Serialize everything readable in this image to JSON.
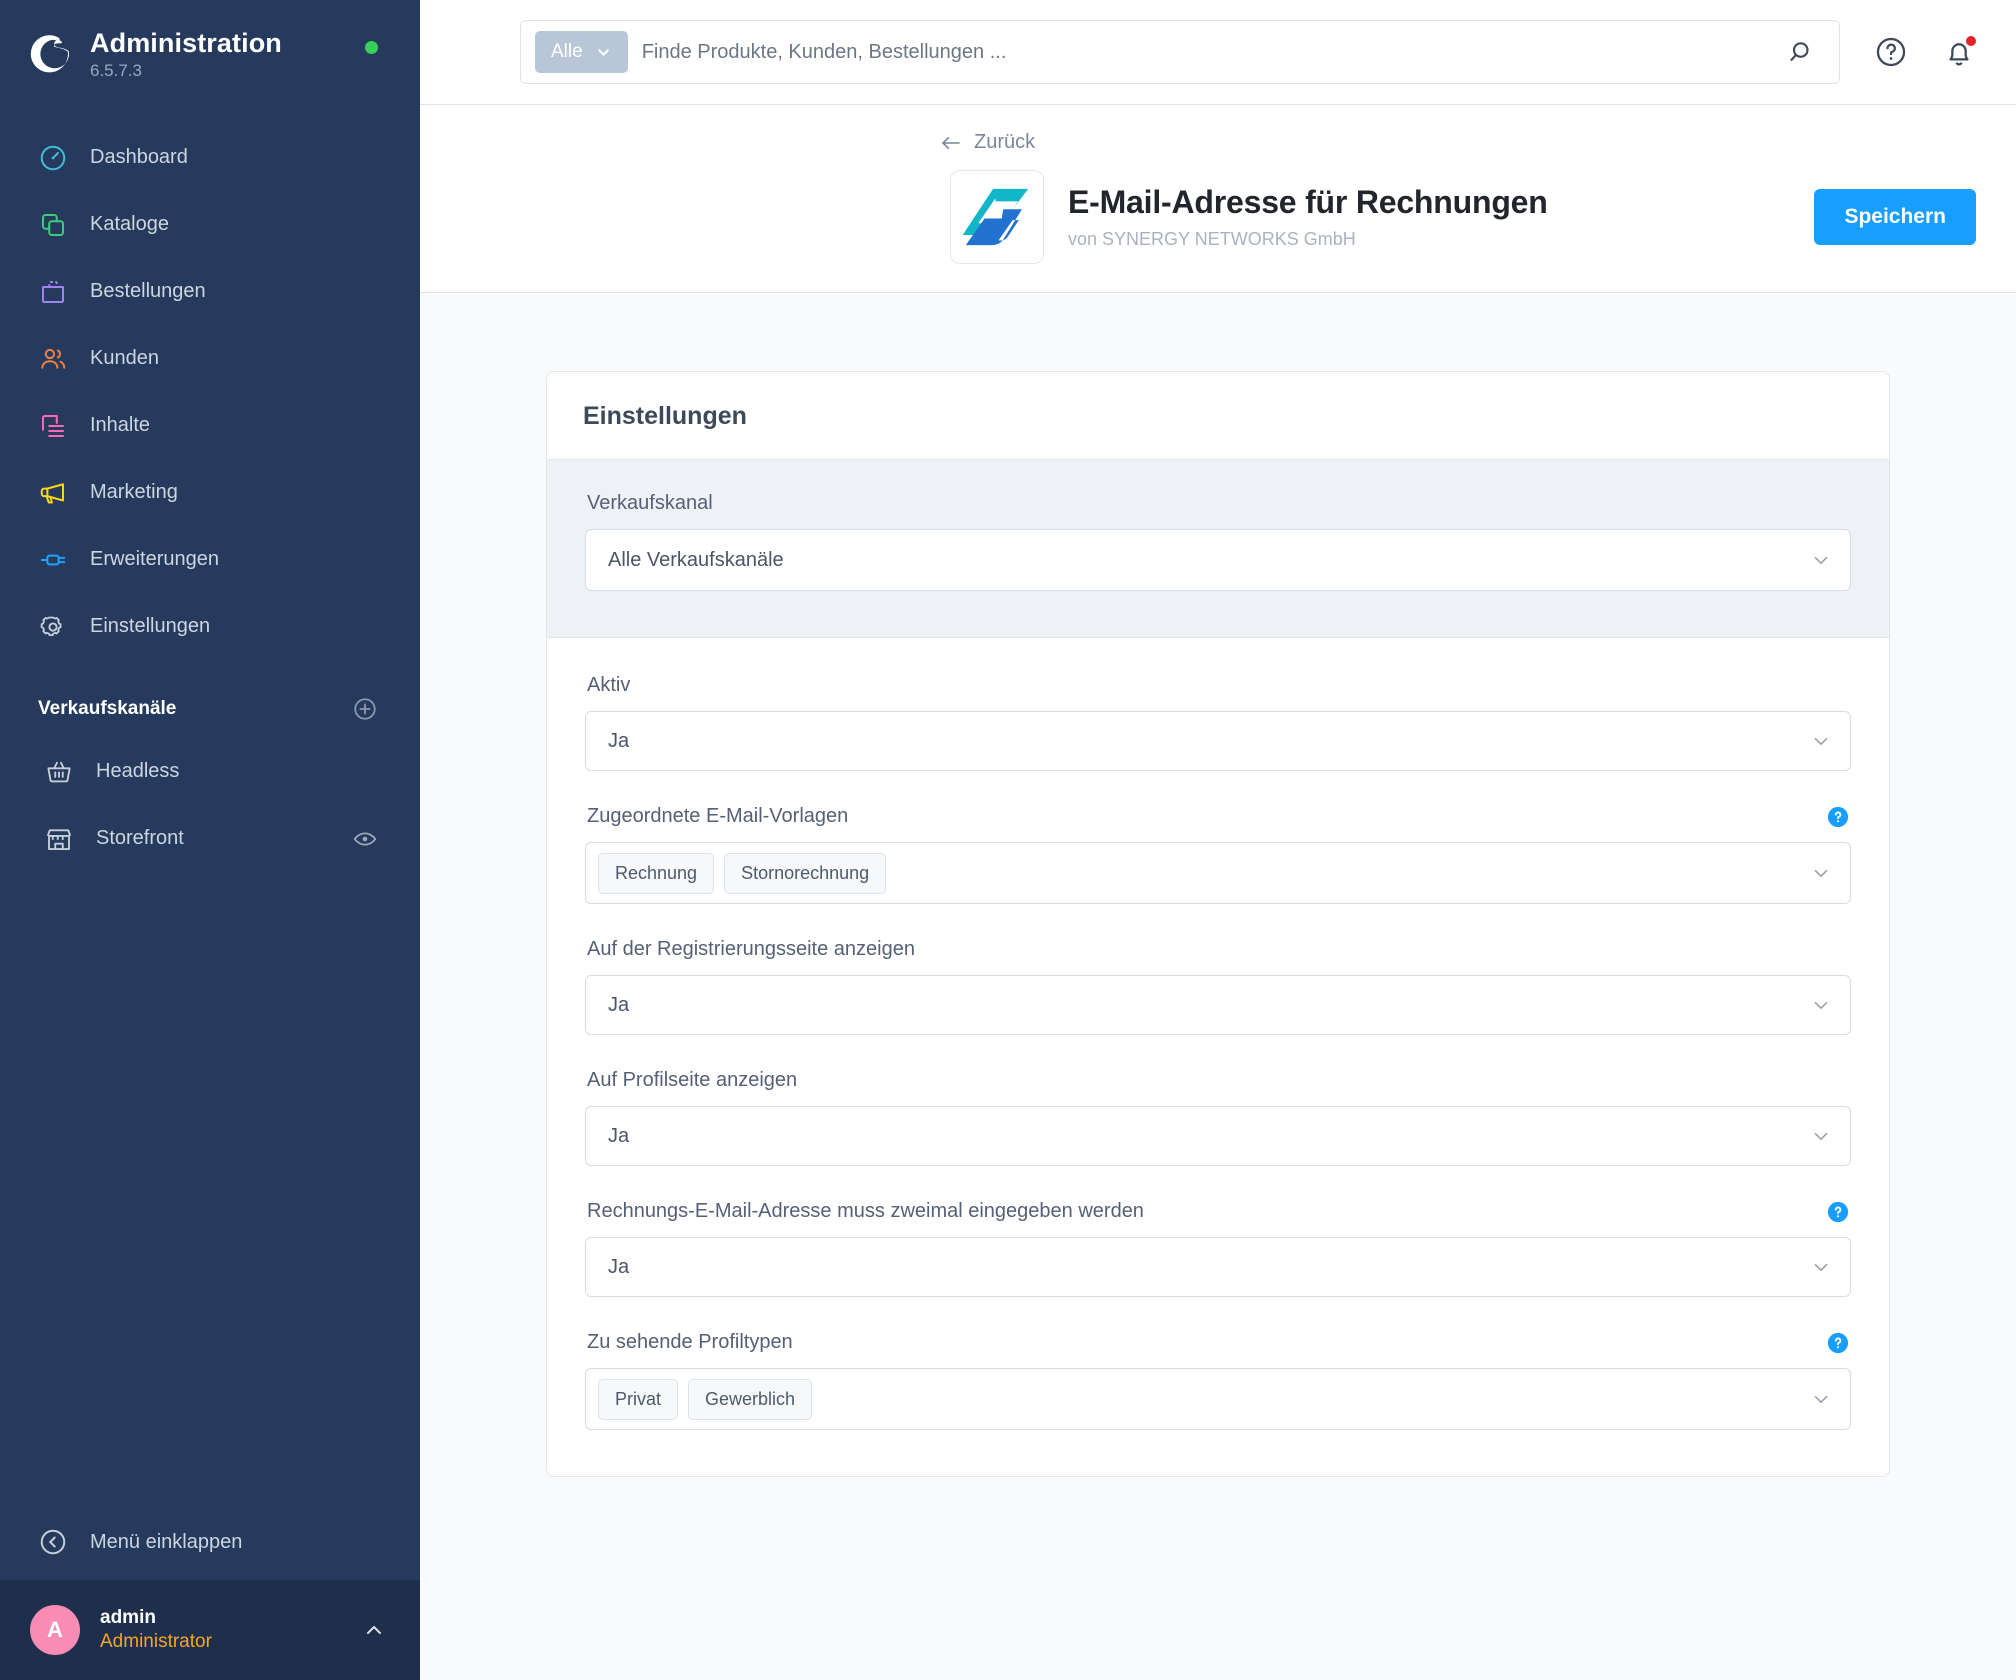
{
  "sidebar": {
    "brand": {
      "title": "Administration",
      "version": "6.5.7.3"
    },
    "status_dot_color": "#37d058",
    "nav": [
      {
        "label": "Dashboard",
        "icon": "dashboard-icon",
        "color": "#41bcd9"
      },
      {
        "label": "Kataloge",
        "icon": "catalog-icon",
        "color": "#3fca7e"
      },
      {
        "label": "Bestellungen",
        "icon": "orders-bag-icon",
        "color": "#a083f0"
      },
      {
        "label": "Kunden",
        "icon": "customers-icon",
        "color": "#f07f42"
      },
      {
        "label": "Inhalte",
        "icon": "content-icon",
        "color": "#ff68b4"
      },
      {
        "label": "Marketing",
        "icon": "megaphone-icon",
        "color": "#ffd60a"
      },
      {
        "label": "Erweiterungen",
        "icon": "plug-icon",
        "color": "#1ea2ff"
      },
      {
        "label": "Einstellungen",
        "icon": "gear-icon",
        "color": "#c6ced9"
      }
    ],
    "section": {
      "title": "Verkaufskanäle",
      "add_icon": "plus-circle-icon"
    },
    "channels": [
      {
        "label": "Headless",
        "icon": "basket-icon",
        "has_eye": false
      },
      {
        "label": "Storefront",
        "icon": "storefront-icon",
        "has_eye": true
      }
    ],
    "collapse": {
      "label": "Menü einklappen",
      "icon": "chevron-left-circle-icon"
    },
    "user": {
      "initial": "A",
      "name": "admin",
      "role": "Administrator",
      "avatar_color": "#f88cb3",
      "role_color": "#f5a623"
    }
  },
  "topbar": {
    "scope_label": "Alle",
    "search_placeholder": "Finde Produkte, Kunden, Bestellungen ...",
    "search_value": "",
    "icons": [
      "search-icon",
      "help-circle-icon",
      "bell-icon"
    ],
    "notification_dot_color": "#e52427"
  },
  "page_header": {
    "back_label": "Zurück",
    "extension_title": "E-Mail-Adresse für Rechnungen",
    "extension_author": "von SYNERGY NETWORKS GmbH",
    "save_label": "Speichern",
    "save_color": "#189eff",
    "logo": {
      "name": "synergy-networks-logo",
      "teal": "#11b6c9",
      "blue": "#2272cf"
    }
  },
  "settings_card": {
    "title": "Einstellungen",
    "sales_channel": {
      "label": "Verkaufskanal",
      "value": "Alle Verkaufskanäle",
      "has_help": false
    },
    "fields": [
      {
        "label": "Aktiv",
        "type": "select",
        "value": "Ja",
        "has_help": false
      },
      {
        "label": "Zugeordnete E-Mail-Vorlagen",
        "type": "multiselect",
        "chips": [
          "Rechnung",
          "Stornorechnung"
        ],
        "has_help": true
      },
      {
        "label": "Auf der Registrierungsseite anzeigen",
        "type": "select",
        "value": "Ja",
        "has_help": false
      },
      {
        "label": "Auf Profilseite anzeigen",
        "type": "select",
        "value": "Ja",
        "has_help": false
      },
      {
        "label": "Rechnungs-E-Mail-Adresse muss zweimal eingegeben werden",
        "type": "select",
        "value": "Ja",
        "has_help": true
      },
      {
        "label": "Zu sehende Profiltypen",
        "type": "multiselect",
        "chips": [
          "Privat",
          "Gewerblich"
        ],
        "has_help": true
      }
    ]
  }
}
